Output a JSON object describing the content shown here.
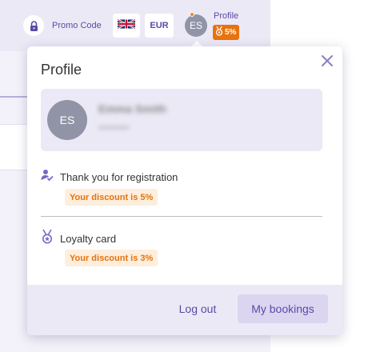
{
  "header": {
    "promo_label": "Promo Code",
    "currency": "EUR",
    "avatar_initials": "ES",
    "profile_label": "Profile",
    "discount_badge": "5%",
    "icons": [
      "lock-icon",
      "uk-flag-icon",
      "medal-icon"
    ]
  },
  "popup": {
    "title": "Profile",
    "user": {
      "initials": "ES",
      "name": "Emma Smith",
      "subtitle": "••••••••••"
    },
    "rewards": [
      {
        "icon": "user-check-icon",
        "text": "Thank you for registration",
        "discount": "Your discount is 5%"
      },
      {
        "icon": "medal-icon",
        "text": "Loyalty card",
        "discount": "Your discount is 3%"
      }
    ],
    "logout_label": "Log out",
    "bookings_label": "My bookings"
  },
  "colors": {
    "accent": "#5b4aa6",
    "discount_text": "#e5730f",
    "discount_bg": "#fdeedd",
    "badge": "#e8730e",
    "panel": "#ece9f6",
    "avatar": "#9094a6"
  }
}
